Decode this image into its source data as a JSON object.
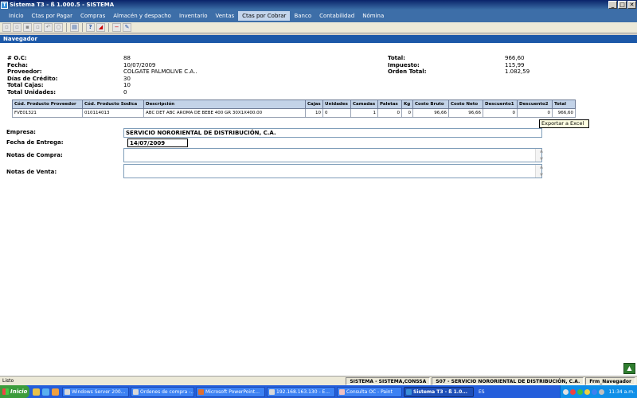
{
  "window": {
    "title": "Sistema T3 - ß 1.000.5 - SISTEMA",
    "buttons": {
      "minimize": "_",
      "restore": "□",
      "close": "✕"
    }
  },
  "menu": [
    {
      "label": "Inicio"
    },
    {
      "label": "Ctas por Pagar"
    },
    {
      "label": "Compras"
    },
    {
      "label": "Almacén y despacho"
    },
    {
      "label": "Inventario"
    },
    {
      "label": "Ventas"
    },
    {
      "label": "Ctas por Cobrar",
      "active": true
    },
    {
      "label": "Banco"
    },
    {
      "label": "Contabilidad"
    },
    {
      "label": "Nómina"
    }
  ],
  "panel": {
    "title": "Navegador"
  },
  "summary": {
    "oc_label": "# O.C:",
    "oc": "88",
    "fecha_label": "Fecha:",
    "fecha": "10/07/2009",
    "proveedor_label": "Proveedor:",
    "proveedor": "COLGATE PALMOLIVE C.A..",
    "dias_label": "Días de Crédito:",
    "dias": "30",
    "cajas_label": "Total Cajas:",
    "cajas": "10",
    "unidades_label": "Total Unidades:",
    "unidades": "0",
    "total_label": "Total:",
    "total": "966,60",
    "impuesto_label": "Impuesto:",
    "impuesto": "115,99",
    "orden_label": "Orden Total:",
    "orden": "1.082,59"
  },
  "table": {
    "headers": [
      "Cód. Producto Proveedor",
      "Cód. Producto Sodica",
      "Descripción",
      "Cajas",
      "Unidades",
      "Camadas",
      "Paletas",
      "Kg",
      "Costo Bruto",
      "Costo Neto",
      "Descuento1",
      "Descuento2",
      "Total"
    ],
    "rows": [
      [
        "FVE01321",
        "010114013",
        "ABC DET ABC AROMA DE BEBE 400 GR 30X1X400.00",
        "10",
        "0",
        "1",
        "0",
        "0",
        "96,66",
        "96,66",
        "0",
        "0",
        "966,60"
      ]
    ]
  },
  "tooltip": "Exportar a Excel",
  "form": {
    "empresa_label": "Empresa:",
    "empresa": "SERVICIO NORORIENTAL DE DISTRIBUCIÓN, C.A.",
    "entrega_label": "Fecha de Entrega:",
    "entrega": "14/07/2009",
    "notas_compra_label": "Notas de Compra:",
    "notas_venta_label": "Notas de Venta:"
  },
  "status": {
    "left": "Listo",
    "user": "SISTEMA - SISTEMA,CONSSA",
    "company": "S07 - SERVICIO NORORIENTAL DE DISTRIBUCIÓN, C.A.",
    "form": "Frm_Navegador"
  },
  "taskbar": {
    "start": "Inicio",
    "tasks": [
      {
        "label": "Windows Server 200..."
      },
      {
        "label": "Ordenes de compra -..."
      },
      {
        "label": "Microsoft PowerPoint..."
      },
      {
        "label": "192.168.163.130 - E..."
      },
      {
        "label": "Consulta OC - Paint"
      },
      {
        "label": "Sistema T3 - ß 1.0...",
        "active": true
      }
    ],
    "lang": "ES",
    "clock": "11:34 a.m."
  }
}
